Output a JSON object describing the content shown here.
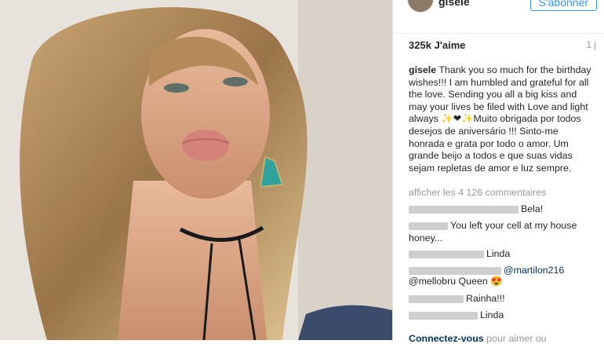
{
  "post": {
    "username": "gisele",
    "follow_label": "S'abonner",
    "likes": "325k J'aime",
    "age": "1 j",
    "caption": "Thank you so much for the birthday wishes!!! I am humbled and grateful for all the love. Sending you all a big kiss and may your lives be filed with Love and light always ✨❤✨Muito obrigada por todos desejos de aniversário !!! Sinto-me honrada e grata por todo o amor. Um grande beijo a todos e que suas vidas sejam repletas de amor e luz sempre.",
    "show_comments": "afficher les 4 126 commentaires",
    "login_link": "Connectez-vous",
    "login_rest": " pour aimer ou"
  },
  "comments": [
    {
      "text": "Bela!"
    },
    {
      "text": "You left your cell at my house honey..."
    },
    {
      "text": "Linda"
    },
    {
      "text": "@martilon216"
    },
    {
      "text": "@mellobru Queen 😍"
    },
    {
      "text": "Rainha!!!"
    },
    {
      "text": "Linda"
    }
  ]
}
